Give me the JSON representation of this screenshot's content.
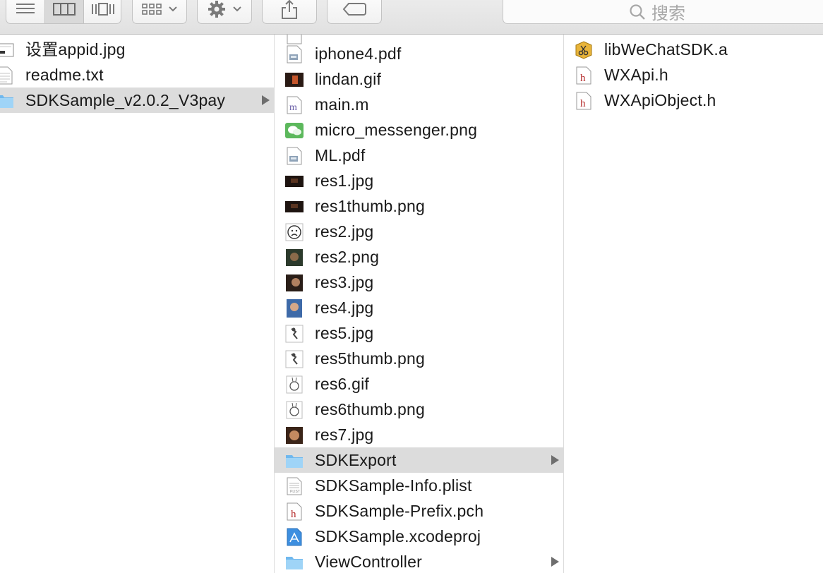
{
  "toolbar": {
    "view_buttons": [
      "list-view",
      "column-view",
      "cover-flow-view"
    ],
    "active_view": "column-view",
    "search": {
      "placeholder": "搜索"
    }
  },
  "columns": {
    "col1": [
      {
        "name": "设置appid.jpg",
        "icon": "image-file-icon"
      },
      {
        "name": "readme.txt",
        "icon": "text-file-icon"
      },
      {
        "name": "SDKSample_v2.0.2_V3pay",
        "icon": "folder-icon",
        "selected": true,
        "has_children": true
      }
    ],
    "col2_partial_top": "",
    "col2": [
      {
        "name": "iphone4.pdf",
        "icon": "pdf-file-icon"
      },
      {
        "name": "lindan.gif",
        "icon": "image-file-icon"
      },
      {
        "name": "main.m",
        "icon": "objc-source-icon"
      },
      {
        "name": "micro_messenger.png",
        "icon": "wechat-image-icon"
      },
      {
        "name": "ML.pdf",
        "icon": "pdf-file-icon"
      },
      {
        "name": "res1.jpg",
        "icon": "image-file-icon"
      },
      {
        "name": "res1thumb.png",
        "icon": "image-file-icon"
      },
      {
        "name": "res2.jpg",
        "icon": "sad-face-image-icon"
      },
      {
        "name": "res2.png",
        "icon": "image-file-icon"
      },
      {
        "name": "res3.jpg",
        "icon": "image-file-icon"
      },
      {
        "name": "res4.jpg",
        "icon": "image-file-icon"
      },
      {
        "name": "res5.jpg",
        "icon": "image-file-icon"
      },
      {
        "name": "res5thumb.png",
        "icon": "image-file-icon"
      },
      {
        "name": "res6.gif",
        "icon": "image-file-icon"
      },
      {
        "name": "res6thumb.png",
        "icon": "image-file-icon"
      },
      {
        "name": "res7.jpg",
        "icon": "image-file-icon"
      },
      {
        "name": "SDKExport",
        "icon": "folder-icon",
        "selected": true,
        "has_children": true
      },
      {
        "name": "SDKSample-Info.plist",
        "icon": "plist-file-icon"
      },
      {
        "name": "SDKSample-Prefix.pch",
        "icon": "header-file-icon"
      },
      {
        "name": "SDKSample.xcodeproj",
        "icon": "xcodeproj-icon"
      },
      {
        "name": "ViewController",
        "icon": "folder-icon",
        "has_children": true
      }
    ],
    "col3": [
      {
        "name": "libWeChatSDK.a",
        "icon": "static-library-icon"
      },
      {
        "name": "WXApi.h",
        "icon": "header-file-icon"
      },
      {
        "name": "WXApiObject.h",
        "icon": "header-file-icon"
      }
    ]
  }
}
